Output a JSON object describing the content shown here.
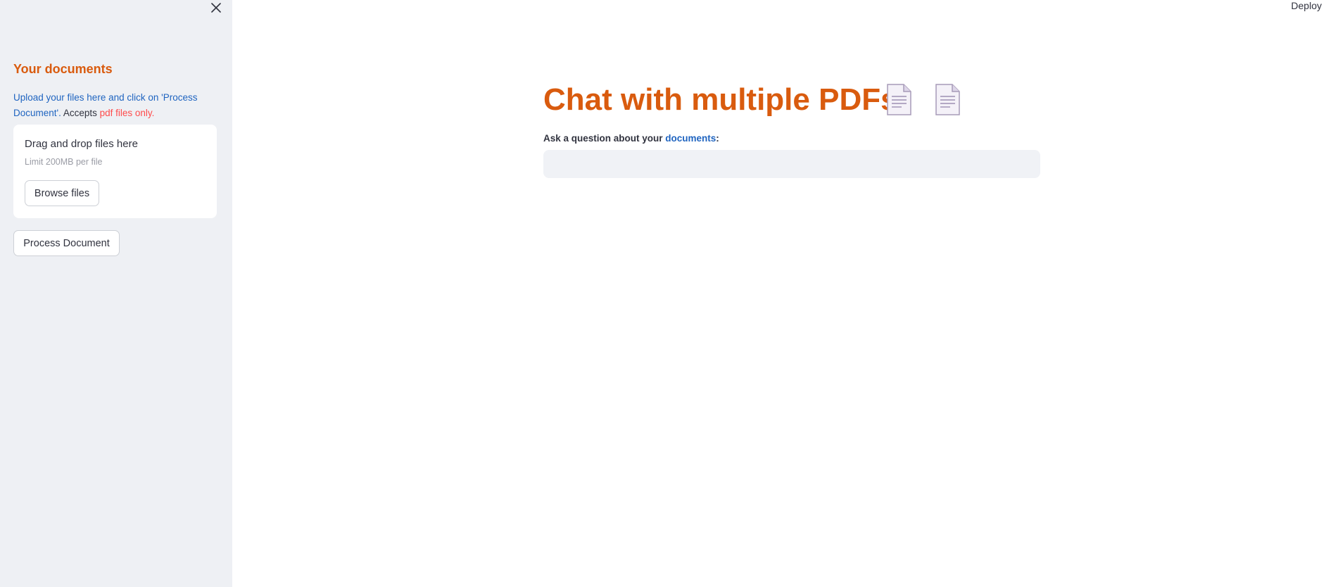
{
  "header": {
    "deploy_label": "Deploy"
  },
  "sidebar": {
    "title": "Your documents",
    "desc_part1": "Upload your files here and click on 'Process Document'.",
    "desc_part2": " Accepts ",
    "desc_part3": "pdf files only.",
    "dropzone": {
      "title": "Drag and drop files here",
      "limit": "Limit 200MB per file",
      "browse_label": "Browse files"
    },
    "process_label": "Process Document"
  },
  "main": {
    "title": "Chat with multiple PDFs",
    "question_label_part1": "Ask a question about your ",
    "question_label_part2": "documents",
    "question_label_part3": ":",
    "question_value": ""
  },
  "colors": {
    "accent": "#d95b0e",
    "link_blue": "#1f64c0",
    "warning_red": "#ff4b4b",
    "sidebar_bg": "#eef0f4"
  },
  "icons": [
    "close-icon",
    "document-icon",
    "document-icon"
  ]
}
